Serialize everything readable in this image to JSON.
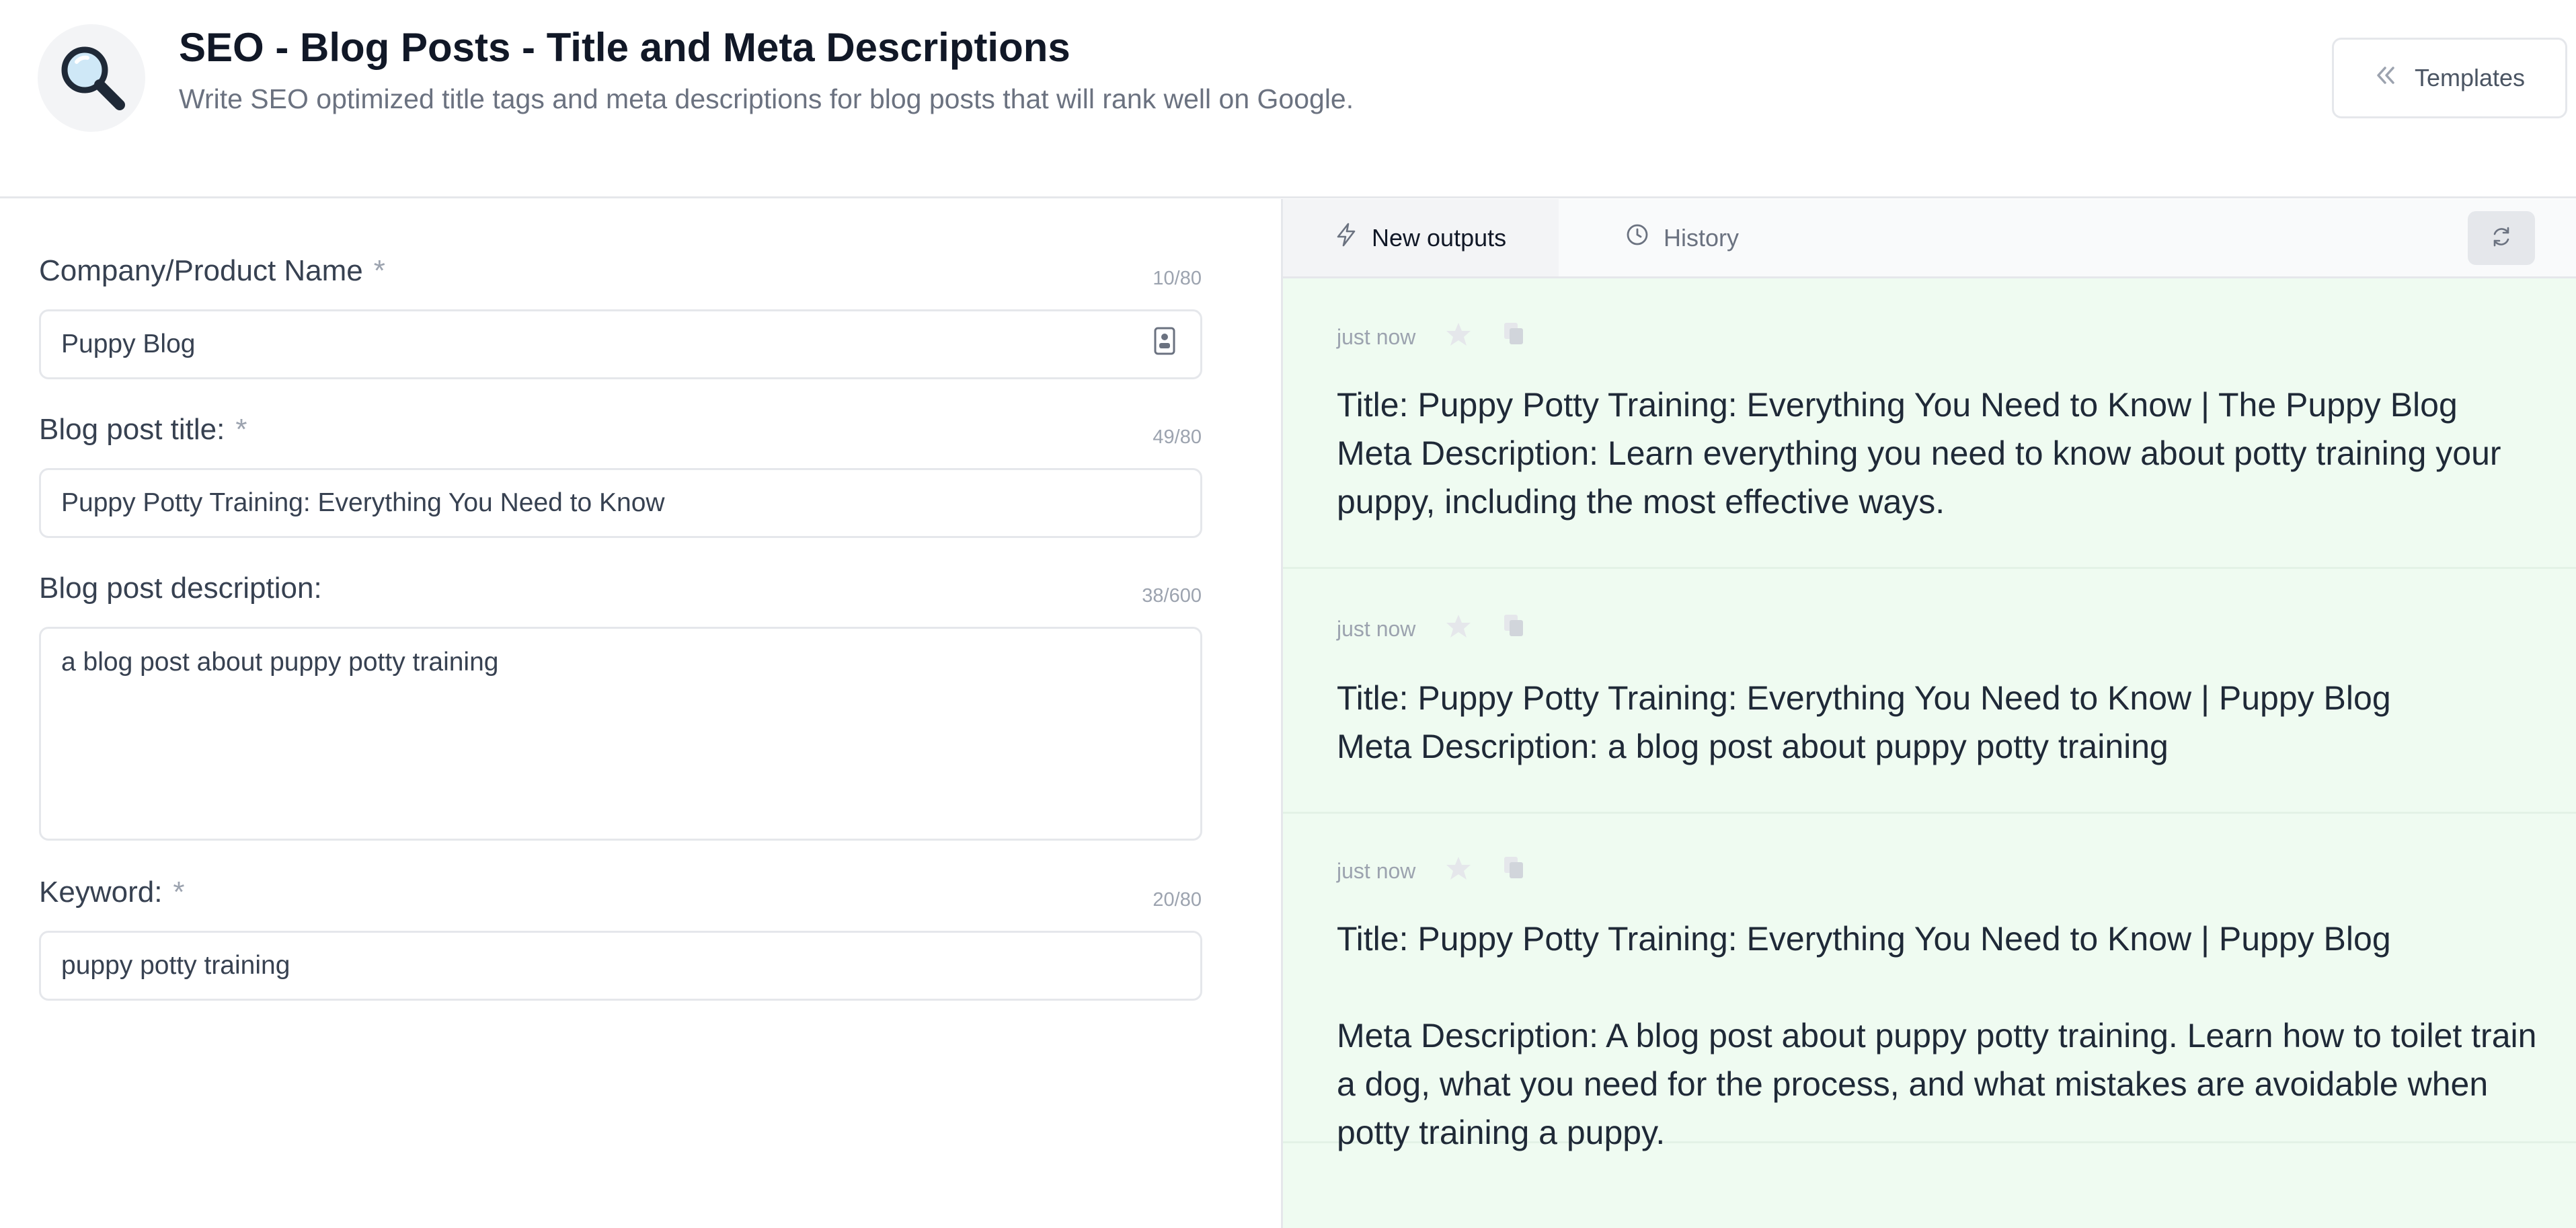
{
  "header": {
    "title": "SEO - Blog Posts - Title and Meta Descriptions",
    "subtitle": "Write SEO optimized title tags and meta descriptions for blog posts that will rank well on Google.",
    "templates_label": "Templates",
    "icon": "magnifying-glass-icon"
  },
  "form": {
    "fields": [
      {
        "label": "Company/Product Name",
        "required": "*",
        "count": "10/80",
        "value": "Puppy Blog",
        "type": "input"
      },
      {
        "label": "Blog post title:",
        "required": "*",
        "count": "49/80",
        "value": "Puppy Potty Training: Everything You Need to Know",
        "type": "input"
      },
      {
        "label": "Blog post description:",
        "required": "",
        "count": "38/600",
        "value": "a blog post about puppy potty training",
        "type": "textarea"
      },
      {
        "label": "Keyword:",
        "required": "*",
        "count": "20/80",
        "value": "puppy potty training",
        "type": "input"
      }
    ]
  },
  "output_panel": {
    "tabs": [
      {
        "label": "New outputs",
        "icon": "lightning-icon",
        "active": true
      },
      {
        "label": "History",
        "icon": "clock-icon",
        "active": false
      }
    ],
    "outputs": [
      {
        "time": "just now",
        "text": "Title: Puppy Potty Training: Everything You Need to Know | The Puppy Blog\nMeta Description: Learn everything you need to know about potty training your puppy, including the most effective ways."
      },
      {
        "time": "just now",
        "text": "Title: Puppy Potty Training: Everything You Need to Know | Puppy Blog\nMeta Description: a blog post about puppy potty training"
      },
      {
        "time": "just now",
        "text": "Title: Puppy Potty Training: Everything You Need to Know | Puppy Blog\n\nMeta Description: A blog post about puppy potty training. Learn how to toilet train a dog, what you need for the process, and what mistakes are avoidable when potty training a puppy."
      }
    ]
  },
  "colors": {
    "output_background": "#effbf1",
    "border": "#e5e7eb",
    "muted_text": "#9ca3af"
  }
}
